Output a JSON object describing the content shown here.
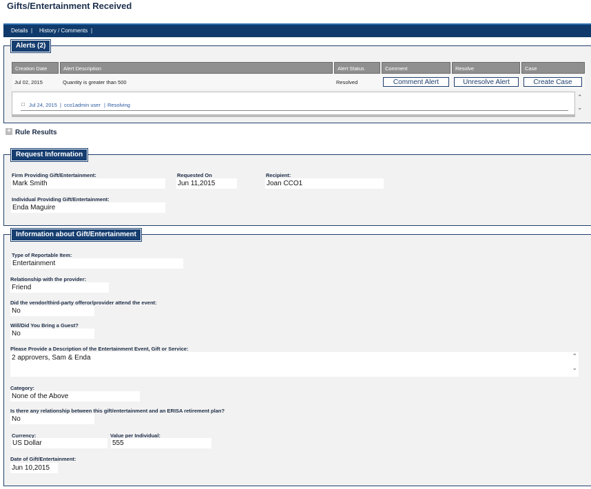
{
  "page": {
    "title": "Gifts/Entertainment Received"
  },
  "nav": {
    "details": "Details",
    "history": "History / Comments"
  },
  "alerts": {
    "legend": "Alerts (2)",
    "headers": [
      "Creation Date",
      "Alert Description",
      "Alert Status",
      "Comment",
      "Resolve",
      "Case"
    ],
    "row": {
      "date": "Jul 02, 2015",
      "description": "Quantity is greater than 500",
      "status": "Resolved",
      "comment_btn": "Comment Alert",
      "resolve_btn": "Unresolve Alert",
      "case_btn": "Create Case"
    },
    "history": {
      "date": "Jul 24, 2015",
      "user": "cco1admin user",
      "action": "Resolving",
      "sep": "|"
    }
  },
  "rule_results": {
    "icon": "+",
    "label": "Rule Results"
  },
  "request": {
    "legend": "Request Information",
    "firm_label": "Firm Providing Gift/Entertainment:",
    "firm_value": "Mark Smith",
    "requested_label": "Requested On",
    "requested_value": "Jun 11,2015",
    "recipient_label": "Recipient:",
    "recipient_value": "Joan CCO1",
    "individual_label": "Individual Providing Gift/Entertainment:",
    "individual_value": "Enda Maguire"
  },
  "info": {
    "legend": "Information about Gift/Entertainment",
    "type_label": "Type of Reportable Item:",
    "type_value": "Entertainment",
    "relationship_label": "Relationship with the provider:",
    "relationship_value": "Friend",
    "attend_label": "Did the vendor/third-party offeror/provider attend the event:",
    "attend_value": "No",
    "guest_label": "Will/Did You Bring a Guest?",
    "guest_value": "No",
    "description_label": "Please Provide a Description of the Entertainment Event, Gift or Service:",
    "description_value": "2 approvers, Sam & Enda",
    "category_label": "Category:",
    "category_value": "None of the Above",
    "erisa_label": "Is there any relationship between this gift/entertainment and an ERISA retirement plan?",
    "erisa_value": "No",
    "currency_label": "Currency:",
    "currency_value": "US Dollar",
    "value_label": "Value per Individual:",
    "value_value": "555",
    "date_label": "Date of Gift/Entertainment:",
    "date_value": "Jun 10,2015"
  }
}
